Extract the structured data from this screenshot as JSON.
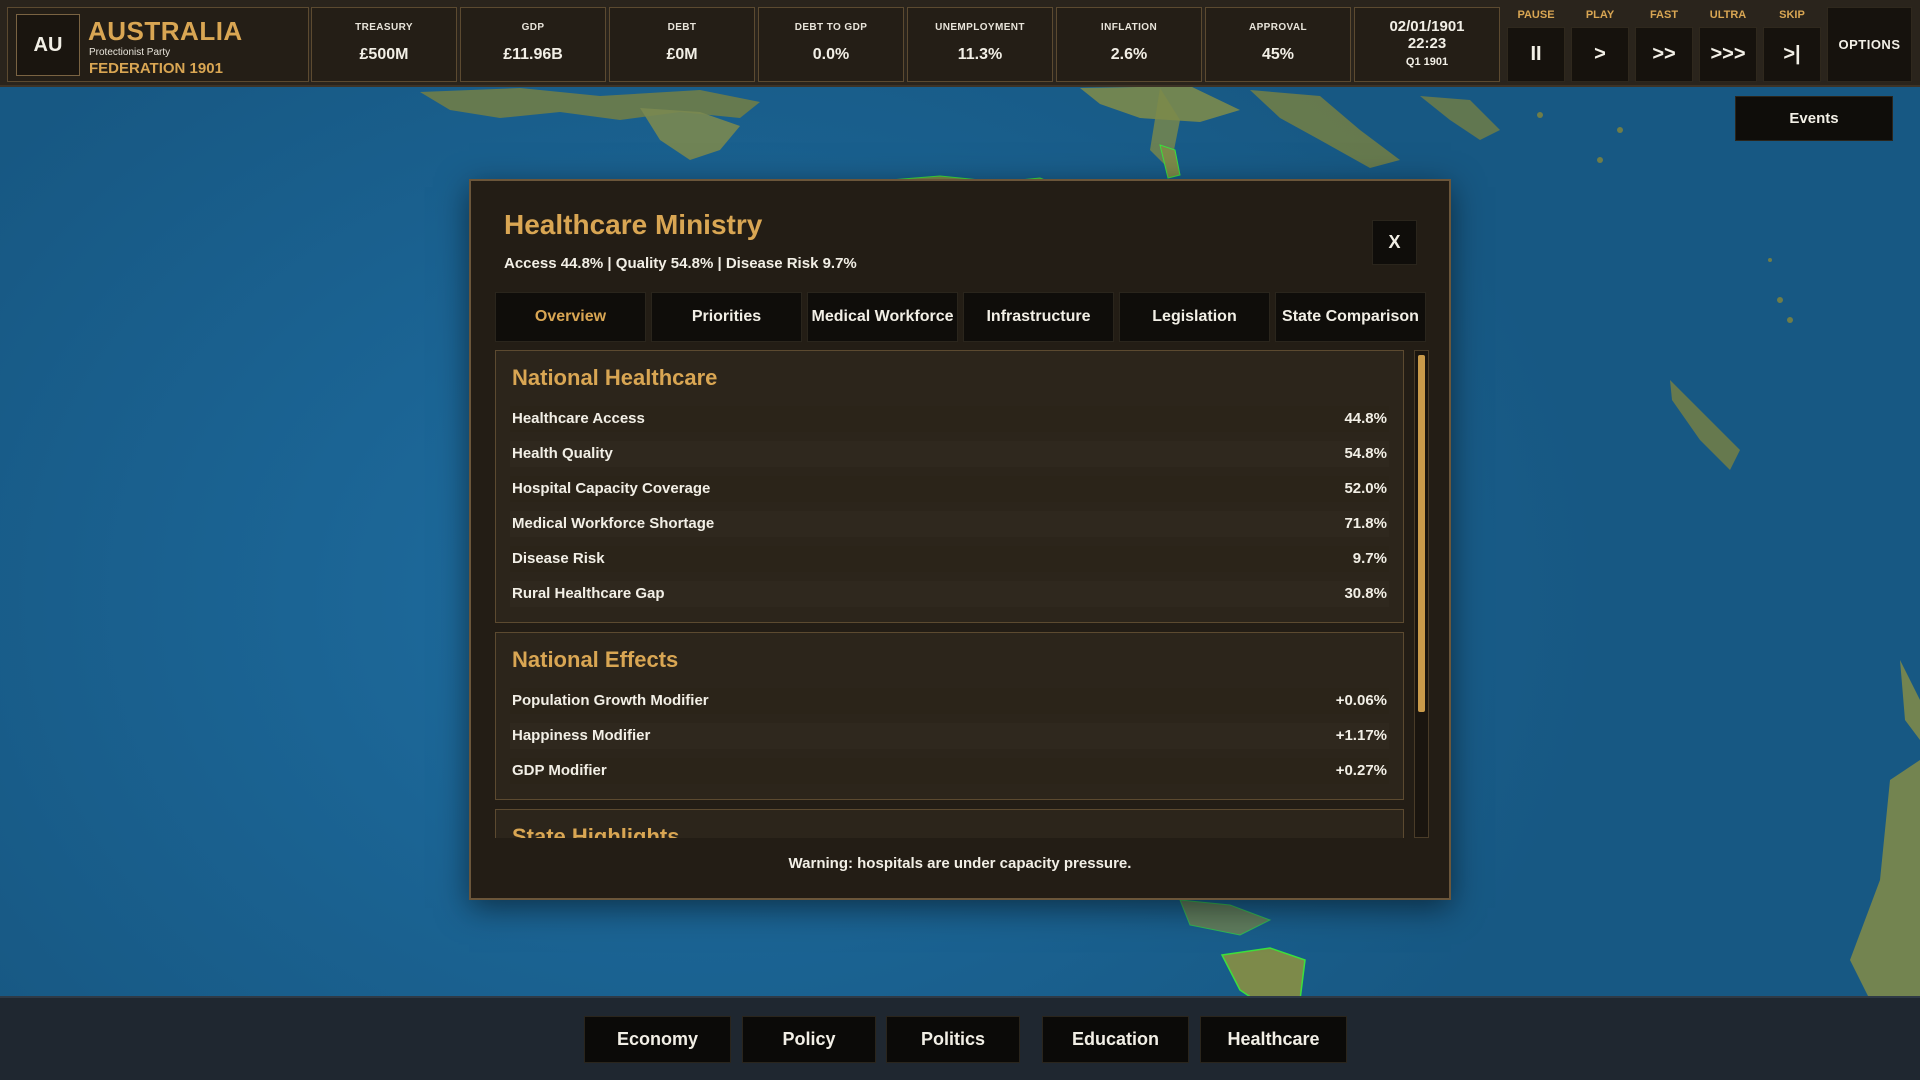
{
  "nation": {
    "code": "AU",
    "name": "AUSTRALIA",
    "party": "Protectionist Party",
    "era": "FEDERATION 1901"
  },
  "stats": [
    {
      "label": "TREASURY",
      "value": "£500M"
    },
    {
      "label": "GDP",
      "value": "£11.96B"
    },
    {
      "label": "DEBT",
      "value": "£0M"
    },
    {
      "label": "DEBT TO GDP",
      "value": "0.0%"
    },
    {
      "label": "UNEMPLOYMENT",
      "value": "11.3%"
    },
    {
      "label": "INFLATION",
      "value": "2.6%"
    },
    {
      "label": "APPROVAL",
      "value": "45%"
    }
  ],
  "date": {
    "date": "02/01/1901",
    "time": "22:23",
    "quarter": "Q1 1901"
  },
  "speed_controls": [
    {
      "label": "PAUSE",
      "symbol": "II"
    },
    {
      "label": "PLAY",
      "symbol": ">"
    },
    {
      "label": "FAST",
      "symbol": ">>"
    },
    {
      "label": "ULTRA",
      "symbol": ">>>"
    },
    {
      "label": "SKIP",
      "symbol": ">|"
    }
  ],
  "options_label": "OPTIONS",
  "events_label": "Events",
  "modal": {
    "title": "Healthcare Ministry",
    "summary": "Access 44.8% | Quality 54.8% | Disease Risk 9.7%",
    "close_label": "X",
    "tabs": [
      {
        "label": "Overview",
        "active": true
      },
      {
        "label": "Priorities",
        "active": false
      },
      {
        "label": "Medical Workforce",
        "active": false
      },
      {
        "label": "Infrastructure",
        "active": false
      },
      {
        "label": "Legislation",
        "active": false
      },
      {
        "label": "State Comparison",
        "active": false
      }
    ],
    "sections": [
      {
        "title": "National Healthcare",
        "rows": [
          {
            "label": "Healthcare Access",
            "value": "44.8%"
          },
          {
            "label": "Health Quality",
            "value": "54.8%"
          },
          {
            "label": "Hospital Capacity Coverage",
            "value": "52.0%"
          },
          {
            "label": "Medical Workforce Shortage",
            "value": "71.8%"
          },
          {
            "label": "Disease Risk",
            "value": "9.7%"
          },
          {
            "label": "Rural Healthcare Gap",
            "value": "30.8%"
          }
        ]
      },
      {
        "title": "National Effects",
        "rows": [
          {
            "label": "Population Growth Modifier",
            "value": "+0.06%"
          },
          {
            "label": "Happiness Modifier",
            "value": "+1.17%"
          },
          {
            "label": "GDP Modifier",
            "value": "+0.27%"
          }
        ]
      },
      {
        "title": "State Highlights",
        "rows": []
      }
    ],
    "warning": "Warning: hospitals are under capacity pressure."
  },
  "bottom_nav": [
    {
      "label": "Economy"
    },
    {
      "label": "Policy"
    },
    {
      "label": "Politics"
    },
    {
      "label": "Education"
    },
    {
      "label": "Healthcare"
    }
  ],
  "colors": {
    "accent_gold": "#d9a653",
    "panel_bg": "#231d15",
    "panel_border": "#6b563a",
    "ocean": "#1b6494",
    "land": "#7d8a4a"
  }
}
